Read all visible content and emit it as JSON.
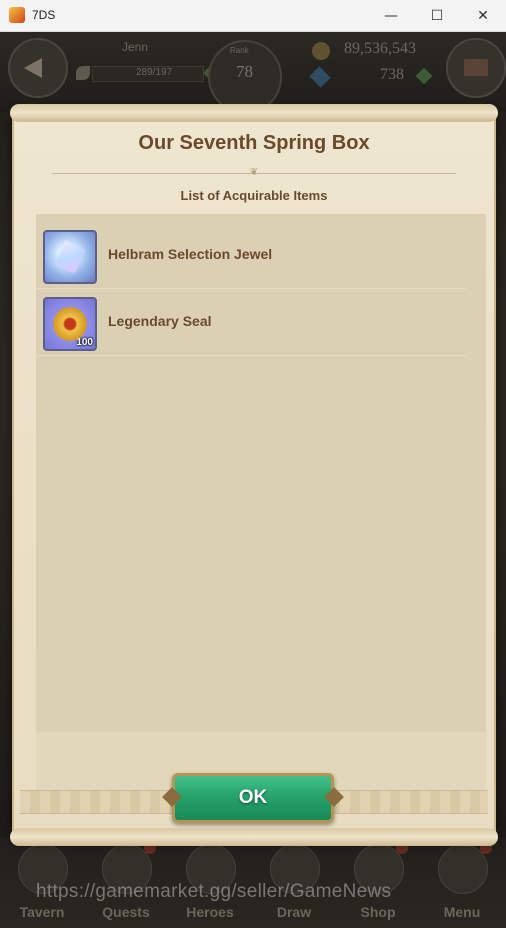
{
  "window": {
    "title": "7DS",
    "minimize_glyph": "—",
    "maximize_glyph": "☐",
    "close_glyph": "✕"
  },
  "hud": {
    "player_name": "Jenn",
    "stamina": "289/197",
    "rank_label": "Rank",
    "rank": "78",
    "gold": "89,536,543",
    "gems": "738"
  },
  "modal": {
    "title": "Our Seventh Spring Box",
    "subtitle": "List of Acquirable Items",
    "items": [
      {
        "name": "Helbram Selection Jewel",
        "icon": "jewel-icon",
        "quantity": ""
      },
      {
        "name": "Legendary Seal",
        "icon": "seal-icon",
        "quantity": "100"
      }
    ],
    "ok_label": "OK",
    "ok_color": "#25a06a"
  },
  "bottom_nav": [
    {
      "label": "Tavern",
      "icon": "tavern-icon"
    },
    {
      "label": "Quests",
      "icon": "quests-icon"
    },
    {
      "label": "Heroes",
      "icon": "heroes-icon"
    },
    {
      "label": "Draw",
      "icon": "draw-icon"
    },
    {
      "label": "Shop",
      "icon": "shop-icon"
    },
    {
      "label": "Menu",
      "icon": "menu-icon"
    }
  ],
  "watermark": "https://gamemarket.gg/seller/GameNews"
}
